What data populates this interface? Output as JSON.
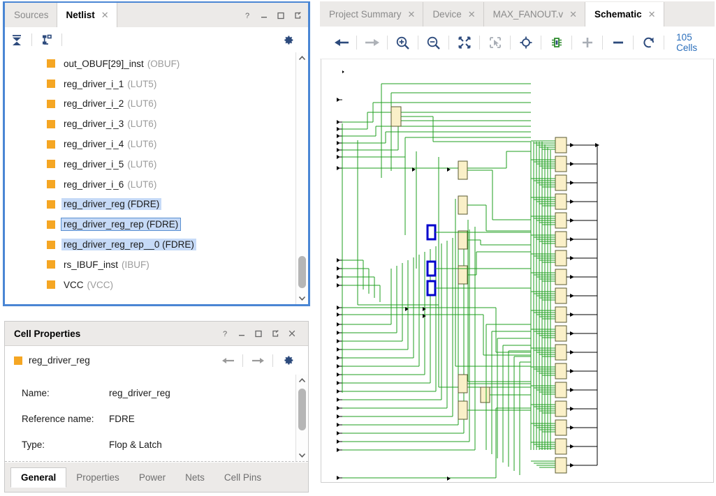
{
  "netlist_panel": {
    "tabs": [
      {
        "label": "Sources",
        "active": false,
        "closable": false
      },
      {
        "label": "Netlist",
        "active": true,
        "closable": true
      }
    ],
    "window_buttons": [
      "?",
      "—",
      "▫",
      "⇱"
    ],
    "toolbar": {
      "collapse_all": "collapse-all-icon",
      "expand_hier": "expand-hierarchy-icon",
      "settings": "gear-icon"
    },
    "tree_items": [
      {
        "name": "out_OBUF[29]_inst",
        "ref": "(OBUF)",
        "selected": false,
        "focused": false
      },
      {
        "name": "reg_driver_i_1",
        "ref": "(LUT5)",
        "selected": false,
        "focused": false
      },
      {
        "name": "reg_driver_i_2",
        "ref": "(LUT6)",
        "selected": false,
        "focused": false
      },
      {
        "name": "reg_driver_i_3",
        "ref": "(LUT6)",
        "selected": false,
        "focused": false
      },
      {
        "name": "reg_driver_i_4",
        "ref": "(LUT6)",
        "selected": false,
        "focused": false
      },
      {
        "name": "reg_driver_i_5",
        "ref": "(LUT6)",
        "selected": false,
        "focused": false
      },
      {
        "name": "reg_driver_i_6",
        "ref": "(LUT6)",
        "selected": false,
        "focused": false
      },
      {
        "name": "reg_driver_reg (FDRE)",
        "ref": "",
        "selected": true,
        "focused": false
      },
      {
        "name": "reg_driver_reg_rep (FDRE)",
        "ref": "",
        "selected": true,
        "focused": true
      },
      {
        "name": "reg_driver_reg_rep__0 (FDRE)",
        "ref": "",
        "selected": true,
        "focused": false
      },
      {
        "name": "rs_IBUF_inst",
        "ref": "(IBUF)",
        "selected": false,
        "focused": false
      },
      {
        "name": "VCC",
        "ref": "(VCC)",
        "selected": false,
        "focused": false
      }
    ]
  },
  "cell_properties": {
    "title": "Cell Properties",
    "window_buttons": [
      "?",
      "—",
      "▫",
      "⇱",
      "✕"
    ],
    "selected_cell": "reg_driver_reg",
    "nav": {
      "back": "back-arrow-icon",
      "forward": "forward-arrow-icon",
      "settings": "gear-icon"
    },
    "rows": [
      {
        "key": "Name:",
        "value": "reg_driver_reg"
      },
      {
        "key": "Reference name:",
        "value": "FDRE"
      },
      {
        "key": "Type:",
        "value": "Flop & Latch"
      }
    ],
    "tabs": [
      {
        "label": "General",
        "active": true
      },
      {
        "label": "Properties",
        "active": false
      },
      {
        "label": "Power",
        "active": false
      },
      {
        "label": "Nets",
        "active": false
      },
      {
        "label": "Cell Pins",
        "active": false
      }
    ]
  },
  "schematic_panel": {
    "tabs": [
      {
        "label": "Project Summary",
        "active": false
      },
      {
        "label": "Device",
        "active": false
      },
      {
        "label": "MAX_FANOUT.v",
        "active": false
      },
      {
        "label": "Schematic",
        "active": true
      }
    ],
    "toolbar_buttons": [
      {
        "name": "back-arrow-icon",
        "enabled": true
      },
      {
        "name": "forward-arrow-icon",
        "enabled": false
      },
      {
        "name": "zoom-in-icon",
        "enabled": true
      },
      {
        "name": "zoom-out-icon",
        "enabled": true
      },
      {
        "name": "zoom-fit-icon",
        "enabled": true
      },
      {
        "name": "zoom-area-icon",
        "enabled": false
      },
      {
        "name": "center-view-icon",
        "enabled": true
      },
      {
        "name": "expand-cell-icon",
        "enabled": true
      },
      {
        "name": "add-cells-icon",
        "enabled": false
      },
      {
        "name": "remove-cells-icon",
        "enabled": true
      },
      {
        "name": "reload-icon",
        "enabled": true
      }
    ],
    "cell_count": "105 Cells"
  },
  "colors": {
    "accent_blue": "#4a86d4",
    "cell_orange": "#f5a623",
    "selection_blue": "#c6daf7",
    "wire_green": "#1f9f1f",
    "cell_fill": "#faf0c8",
    "highlight_blue": "#0000cc",
    "link_blue": "#2a6ebb",
    "panel_grey": "#eceae8"
  }
}
